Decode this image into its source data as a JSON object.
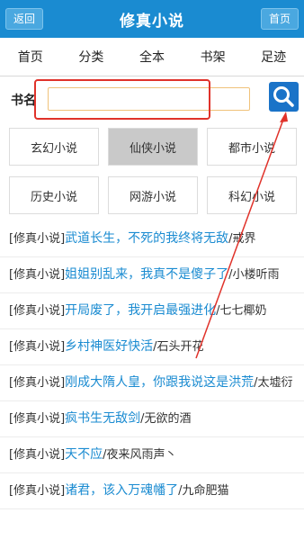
{
  "header": {
    "back_label": "返回",
    "title": "修真小说",
    "home_label": "首页"
  },
  "nav": {
    "items": [
      "首页",
      "分类",
      "全本",
      "书架",
      "足迹"
    ]
  },
  "search": {
    "label": "书名",
    "value": ""
  },
  "categories": [
    {
      "label": "玄幻小说",
      "active": false
    },
    {
      "label": "仙侠小说",
      "active": true
    },
    {
      "label": "都市小说",
      "active": false
    },
    {
      "label": "历史小说",
      "active": false
    },
    {
      "label": "网游小说",
      "active": false
    },
    {
      "label": "科幻小说",
      "active": false
    }
  ],
  "list": [
    {
      "tag": "[修真小说]",
      "title": "武道长生，不死的我终将无敌",
      "author": "/戒界"
    },
    {
      "tag": "[修真小说]",
      "title": "姐姐别乱来，我真不是傻子了",
      "author": "/小楼听雨"
    },
    {
      "tag": "[修真小说]",
      "title": "开局废了，我开启最强进化",
      "author": "/七七椰奶"
    },
    {
      "tag": "[修真小说]",
      "title": "乡村神医好快活",
      "author": "/石头开花"
    },
    {
      "tag": "[修真小说]",
      "title": "刚成大隋人皇，你跟我说这是洪荒",
      "author": "/太墟衍"
    },
    {
      "tag": "[修真小说]",
      "title": "疯书生无敌剑",
      "author": "/无欲的酒"
    },
    {
      "tag": "[修真小说]",
      "title": "天不应",
      "author": "/夜来风雨声丶"
    },
    {
      "tag": "[修真小说]",
      "title": "诸君，该入万魂幡了",
      "author": "/九命肥猫"
    }
  ],
  "colors": {
    "header_bg": "#1a8bd1",
    "link": "#1a8bd1",
    "annotation": "#e0322a"
  },
  "icons": {
    "search": "search-icon"
  }
}
